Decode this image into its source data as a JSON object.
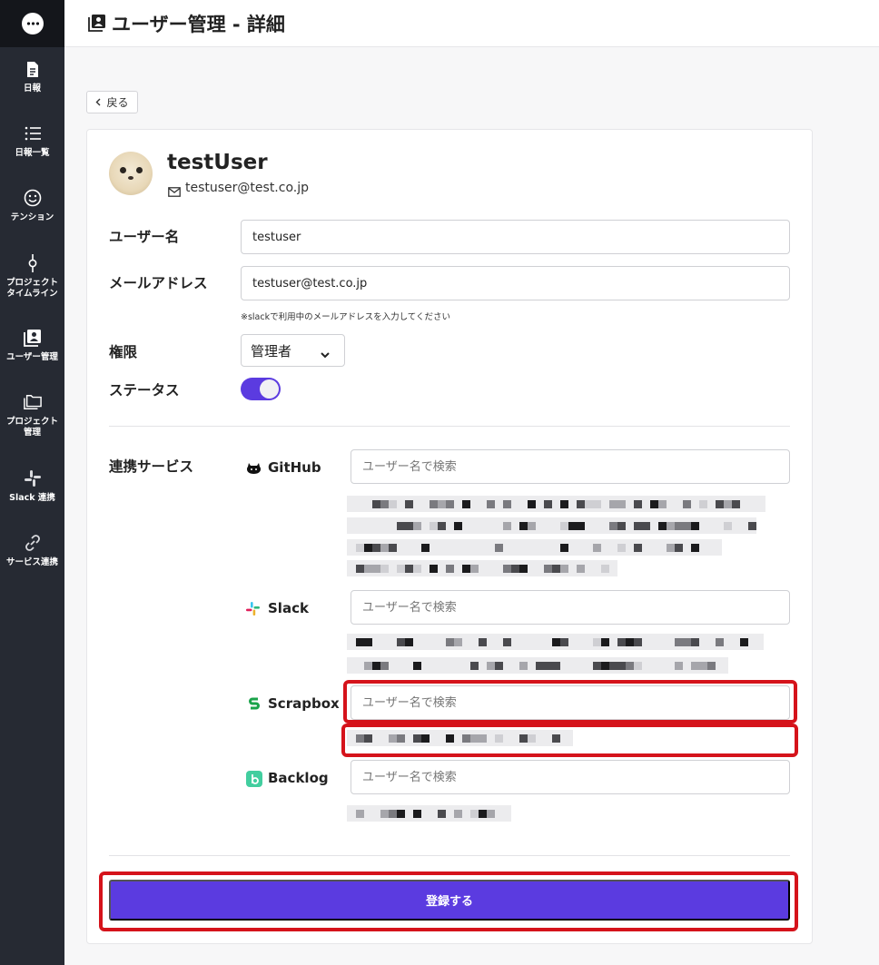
{
  "sidebar": {
    "items": [
      {
        "label": "日報",
        "icon": "document-icon"
      },
      {
        "label": "日報一覧",
        "icon": "list-icon"
      },
      {
        "label": "テンション",
        "icon": "smile-icon"
      },
      {
        "label": "プロジェクト\nタイムライン",
        "icon": "timeline-icon"
      },
      {
        "label": "ユーザー管理",
        "icon": "user-book-icon"
      },
      {
        "label": "プロジェクト\n管理",
        "icon": "folder-icon"
      },
      {
        "label": "Slack 連携",
        "icon": "slack-icon"
      },
      {
        "label": "サービス連携",
        "icon": "link-icon"
      }
    ]
  },
  "header": {
    "title": "ユーザー管理 - 詳細"
  },
  "back": {
    "label": "戻る"
  },
  "profile": {
    "name": "testUser",
    "email": "testuser@test.co.jp"
  },
  "form": {
    "username_label": "ユーザー名",
    "username_value": "testuser",
    "email_label": "メールアドレス",
    "email_value": "testuser@test.co.jp",
    "email_hint": "※slackで利用中のメールアドレスを入力してください",
    "role_label": "権限",
    "role_value": "管理者",
    "status_label": "ステータス",
    "status_on": true
  },
  "integrations": {
    "label": "連携サービス",
    "search_placeholder": "ユーザー名で検索",
    "services": [
      {
        "name": "GitHub",
        "icon": "github-icon"
      },
      {
        "name": "Slack",
        "icon": "slack-icon"
      },
      {
        "name": "Scrapbox",
        "icon": "scrapbox-icon"
      },
      {
        "name": "Backlog",
        "icon": "backlog-icon"
      }
    ]
  },
  "submit": {
    "label": "登録する"
  },
  "colors": {
    "accent": "#5b3be0",
    "sidebar": "#262a33",
    "highlight": "#d5131b"
  }
}
